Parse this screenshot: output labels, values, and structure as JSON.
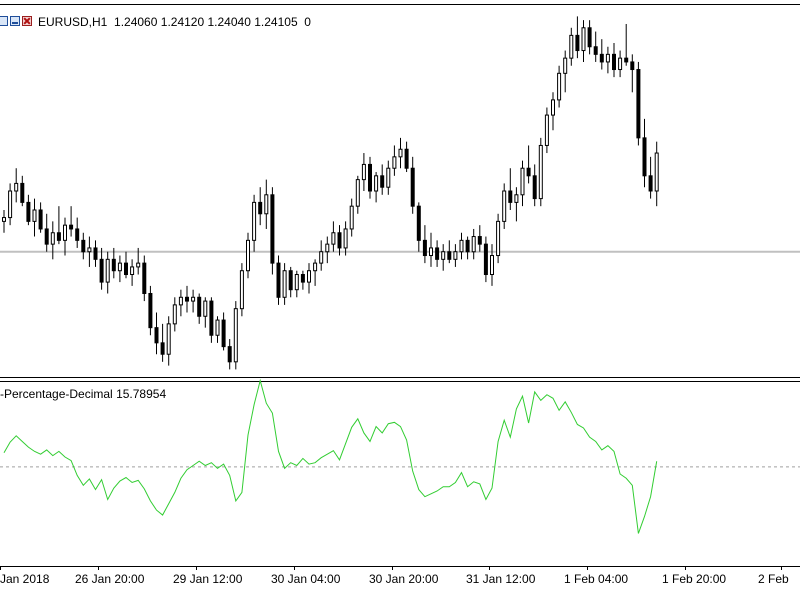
{
  "window": {
    "symbol_info": "EURUSD,H1",
    "open": "1.24060",
    "high": "1.24120",
    "low": "1.24040",
    "close": "1.24105",
    "volume": "0",
    "icons": [
      "window-restore-icon",
      "window-minimize-icon",
      "window-close-icon"
    ]
  },
  "indicator": {
    "label": "-Percentage-Decimal",
    "value": "15.78954",
    "line_color": "#32cd32",
    "level_line_color": "#a0a0a0"
  },
  "colors": {
    "background": "#ffffff",
    "bull_candle": "#ffffff",
    "bear_candle": "#000000",
    "grid_level": "#c0c0c0"
  },
  "time_axis": [
    "Jan 2018",
    "26 Jan 20:00",
    "29 Jan 12:00",
    "30 Jan 04:00",
    "30 Jan 20:00",
    "31 Jan 12:00",
    "1 Feb 04:00",
    "1 Feb 20:00",
    "2 Feb"
  ],
  "chart_data": {
    "type": "candlestick",
    "symbol": "EURUSD",
    "timeframe": "H1",
    "ohlc": [
      [
        1.2406,
        1.2409,
        1.2403,
        1.2407
      ],
      [
        1.2407,
        1.2416,
        1.2405,
        1.2414
      ],
      [
        1.2414,
        1.242,
        1.2411,
        1.2416
      ],
      [
        1.2416,
        1.2418,
        1.241,
        1.2411
      ],
      [
        1.2411,
        1.2413,
        1.2405,
        1.2406
      ],
      [
        1.2406,
        1.2412,
        1.2402,
        1.2409
      ],
      [
        1.2409,
        1.2411,
        1.2403,
        1.2404
      ],
      [
        1.2404,
        1.2408,
        1.2398,
        1.24
      ],
      [
        1.24,
        1.2406,
        1.2396,
        1.2403
      ],
      [
        1.2403,
        1.241,
        1.24,
        1.2401
      ],
      [
        1.2401,
        1.2407,
        1.2397,
        1.2405
      ],
      [
        1.2405,
        1.241,
        1.2402,
        1.2404
      ],
      [
        1.2404,
        1.2407,
        1.2399,
        1.2401
      ],
      [
        1.2401,
        1.2403,
        1.2396,
        1.2398
      ],
      [
        1.2398,
        1.2402,
        1.2394,
        1.2399
      ],
      [
        1.2399,
        1.2401,
        1.2394,
        1.2396
      ],
      [
        1.2396,
        1.2399,
        1.2388,
        1.239
      ],
      [
        1.239,
        1.2398,
        1.2387,
        1.2396
      ],
      [
        1.2396,
        1.2399,
        1.2391,
        1.2393
      ],
      [
        1.2393,
        1.2397,
        1.239,
        1.2395
      ],
      [
        1.2395,
        1.2398,
        1.2391,
        1.2392
      ],
      [
        1.2392,
        1.2396,
        1.2389,
        1.2394
      ],
      [
        1.2394,
        1.2399,
        1.2392,
        1.2395
      ],
      [
        1.2395,
        1.2397,
        1.2385,
        1.2387
      ],
      [
        1.2387,
        1.2389,
        1.2376,
        1.2378
      ],
      [
        1.2378,
        1.2382,
        1.2371,
        1.2374
      ],
      [
        1.2374,
        1.2379,
        1.2369,
        1.2371
      ],
      [
        1.2371,
        1.2381,
        1.2368,
        1.2379
      ],
      [
        1.2379,
        1.2386,
        1.2377,
        1.2384
      ],
      [
        1.2384,
        1.2388,
        1.2381,
        1.2386
      ],
      [
        1.2386,
        1.2389,
        1.2382,
        1.2385
      ],
      [
        1.2385,
        1.2388,
        1.2382,
        1.2386
      ],
      [
        1.2386,
        1.2387,
        1.2379,
        1.2381
      ],
      [
        1.2381,
        1.2386,
        1.2378,
        1.2385
      ],
      [
        1.2385,
        1.2386,
        1.2374,
        1.2376
      ],
      [
        1.2376,
        1.2381,
        1.2374,
        1.238
      ],
      [
        1.238,
        1.2382,
        1.2372,
        1.2373
      ],
      [
        1.2373,
        1.2375,
        1.2367,
        1.2369
      ],
      [
        1.2369,
        1.2385,
        1.2367,
        1.2383
      ],
      [
        1.2383,
        1.2395,
        1.2381,
        1.2393
      ],
      [
        1.2393,
        1.2403,
        1.2391,
        1.2401
      ],
      [
        1.2401,
        1.2413,
        1.2398,
        1.2411
      ],
      [
        1.2411,
        1.2415,
        1.2405,
        1.2408
      ],
      [
        1.2408,
        1.2417,
        1.2404,
        1.2413
      ],
      [
        1.2413,
        1.2415,
        1.2392,
        1.2395
      ],
      [
        1.2395,
        1.2397,
        1.2384,
        1.2386
      ],
      [
        1.2386,
        1.2395,
        1.2384,
        1.2393
      ],
      [
        1.2393,
        1.2394,
        1.2386,
        1.2388
      ],
      [
        1.2388,
        1.2393,
        1.2386,
        1.2392
      ],
      [
        1.2392,
        1.2393,
        1.2388,
        1.239
      ],
      [
        1.239,
        1.2395,
        1.2387,
        1.2393
      ],
      [
        1.2393,
        1.2396,
        1.2389,
        1.2395
      ],
      [
        1.2395,
        1.2401,
        1.2393,
        1.2398
      ],
      [
        1.2398,
        1.2402,
        1.2395,
        1.24
      ],
      [
        1.24,
        1.2406,
        1.2398,
        1.2403
      ],
      [
        1.2403,
        1.2405,
        1.2397,
        1.2399
      ],
      [
        1.2399,
        1.2406,
        1.2397,
        1.2404
      ],
      [
        1.2404,
        1.2412,
        1.2402,
        1.241
      ],
      [
        1.241,
        1.2418,
        1.2408,
        1.2417
      ],
      [
        1.2417,
        1.2424,
        1.2414,
        1.2421
      ],
      [
        1.2421,
        1.2423,
        1.2412,
        1.2414
      ],
      [
        1.2414,
        1.2419,
        1.2411,
        1.2418
      ],
      [
        1.2418,
        1.2421,
        1.2413,
        1.2415
      ],
      [
        1.2415,
        1.2422,
        1.2413,
        1.242
      ],
      [
        1.242,
        1.2426,
        1.2418,
        1.2423
      ],
      [
        1.2423,
        1.2428,
        1.242,
        1.2425
      ],
      [
        1.2425,
        1.2427,
        1.2419,
        1.242
      ],
      [
        1.242,
        1.2423,
        1.2408,
        1.241
      ],
      [
        1.241,
        1.2411,
        1.2398,
        1.2401
      ],
      [
        1.2401,
        1.2405,
        1.2395,
        1.2397
      ],
      [
        1.2397,
        1.2403,
        1.2394,
        1.2399
      ],
      [
        1.2399,
        1.2401,
        1.2394,
        1.2396
      ],
      [
        1.2396,
        1.24,
        1.2393,
        1.2398
      ],
      [
        1.2398,
        1.2401,
        1.2395,
        1.2396
      ],
      [
        1.2396,
        1.24,
        1.2394,
        1.2398
      ],
      [
        1.2398,
        1.2403,
        1.2396,
        1.2401
      ],
      [
        1.2401,
        1.2402,
        1.2396,
        1.2398
      ],
      [
        1.2398,
        1.2404,
        1.2396,
        1.2402
      ],
      [
        1.2402,
        1.2405,
        1.2398,
        1.24
      ],
      [
        1.24,
        1.2402,
        1.239,
        1.2392
      ],
      [
        1.2392,
        1.24,
        1.2389,
        1.2397
      ],
      [
        1.2397,
        1.2408,
        1.2395,
        1.2406
      ],
      [
        1.2406,
        1.2416,
        1.2404,
        1.2414
      ],
      [
        1.2414,
        1.242,
        1.2409,
        1.2411
      ],
      [
        1.2411,
        1.2415,
        1.2406,
        1.2413
      ],
      [
        1.2413,
        1.2422,
        1.241,
        1.242
      ],
      [
        1.242,
        1.2426,
        1.2416,
        1.2418
      ],
      [
        1.2418,
        1.2421,
        1.241,
        1.2412
      ],
      [
        1.2412,
        1.2428,
        1.241,
        1.2426
      ],
      [
        1.2426,
        1.2436,
        1.2424,
        1.2434
      ],
      [
        1.2434,
        1.244,
        1.243,
        1.2438
      ],
      [
        1.2438,
        1.2447,
        1.2436,
        1.2445
      ],
      [
        1.2445,
        1.2451,
        1.244,
        1.2449
      ],
      [
        1.2449,
        1.2457,
        1.2447,
        1.2455
      ],
      [
        1.2455,
        1.246,
        1.2449,
        1.2451
      ],
      [
        1.2451,
        1.2459,
        1.2448,
        1.2457
      ],
      [
        1.2457,
        1.2459,
        1.245,
        1.2452
      ],
      [
        1.2452,
        1.2456,
        1.2448,
        1.245
      ],
      [
        1.245,
        1.2454,
        1.2446,
        1.2448
      ],
      [
        1.2448,
        1.2452,
        1.2445,
        1.245
      ],
      [
        1.245,
        1.2453,
        1.2444,
        1.2446
      ],
      [
        1.2446,
        1.2451,
        1.2444,
        1.2449
      ],
      [
        1.2449,
        1.2458,
        1.2447,
        1.2448
      ],
      [
        1.2448,
        1.245,
        1.244,
        1.2446
      ],
      [
        1.2446,
        1.2448,
        1.2426,
        1.2428
      ],
      [
        1.2428,
        1.2433,
        1.2415,
        1.2418
      ],
      [
        1.2418,
        1.2423,
        1.2412,
        1.2414
      ],
      [
        1.2414,
        1.2427,
        1.241,
        1.2424
      ]
    ],
    "indicator": {
      "name": "-Percentage-Decimal",
      "last_value": 15.78954,
      "values": [
        2.0,
        3.5,
        4.4,
        3.6,
        2.8,
        2.2,
        1.8,
        2.4,
        1.6,
        2.2,
        1.4,
        0.9,
        -1.2,
        -2.6,
        -1.7,
        -3.2,
        -1.8,
        -4.6,
        -3.0,
        -2.0,
        -1.5,
        -2.2,
        -1.9,
        -3.1,
        -4.8,
        -6.1,
        -6.8,
        -5.2,
        -3.6,
        -1.6,
        -0.4,
        0.2,
        0.8,
        0.2,
        0.6,
        -0.2,
        0.4,
        -1.2,
        -4.8,
        -3.6,
        4.5,
        8.8,
        12.2,
        9.0,
        7.6,
        2.2,
        -0.2,
        0.6,
        0.2,
        1.2,
        0.4,
        0.6,
        1.3,
        1.8,
        2.3,
        1.0,
        3.3,
        5.6,
        6.8,
        4.8,
        3.6,
        5.7,
        4.8,
        6.1,
        6.3,
        5.7,
        3.8,
        -0.6,
        -3.2,
        -4.2,
        -3.8,
        -3.4,
        -2.8,
        -2.8,
        -2.2,
        -0.8,
        -2.8,
        -2.1,
        -2.4,
        -4.6,
        -3.0,
        3.6,
        6.6,
        4.2,
        8.2,
        10.0,
        6.2,
        10.6,
        9.4,
        10.2,
        9.7,
        8.0,
        9.2,
        7.7,
        6.0,
        5.5,
        4.2,
        3.6,
        2.4,
        3.0,
        2.2,
        -1.0,
        -1.6,
        -2.6,
        -9.4,
        -7.0,
        -4.2,
        0.8
      ]
    },
    "level_line": 1.2398,
    "indicator_zero_line": 0,
    "price_range": [
      1.2365,
      1.2463
    ],
    "indicator_range": [
      -14.0,
      12.0
    ],
    "grid": false,
    "legend": "none"
  }
}
